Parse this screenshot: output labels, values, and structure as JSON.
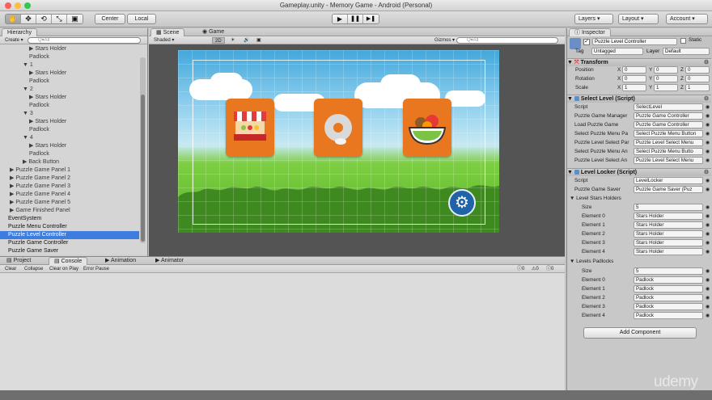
{
  "window": {
    "title": "Gameplay.unity - Memory Game - Android (Personal)"
  },
  "toolbar": {
    "tools": [
      "hand-icon",
      "move-icon",
      "rotate-icon",
      "scale-icon",
      "rect-icon"
    ],
    "center_label": "Center",
    "local_label": "Local",
    "layers_label": "Layers",
    "layout_label": "Layout",
    "account_label": "Account"
  },
  "hierarchy": {
    "tab_label": "Hierarchy",
    "create_label": "Create",
    "search_placeholder": "Q▾All",
    "rows": [
      {
        "text": "▶ Stars Holder",
        "indent": 36,
        "bold": false,
        "selected": false
      },
      {
        "text": "Padlock",
        "indent": 36,
        "bold": false,
        "selected": false
      },
      {
        "text": "▼ 1",
        "indent": 28,
        "bold": false,
        "selected": false
      },
      {
        "text": "▶ Stars Holder",
        "indent": 36,
        "bold": false,
        "selected": false
      },
      {
        "text": "Padlock",
        "indent": 36,
        "bold": false,
        "selected": false
      },
      {
        "text": "▼ 2",
        "indent": 28,
        "bold": false,
        "selected": false
      },
      {
        "text": "▶ Stars Holder",
        "indent": 36,
        "bold": false,
        "selected": false
      },
      {
        "text": "Padlock",
        "indent": 36,
        "bold": false,
        "selected": false
      },
      {
        "text": "▼ 3",
        "indent": 28,
        "bold": false,
        "selected": false
      },
      {
        "text": "▶ Stars Holder",
        "indent": 36,
        "bold": false,
        "selected": false
      },
      {
        "text": "Padlock",
        "indent": 36,
        "bold": false,
        "selected": false
      },
      {
        "text": "▼ 4",
        "indent": 28,
        "bold": false,
        "selected": false
      },
      {
        "text": "▶ Stars Holder",
        "indent": 36,
        "bold": false,
        "selected": false
      },
      {
        "text": "Padlock",
        "indent": 36,
        "bold": false,
        "selected": false
      },
      {
        "text": "▶ Back Button",
        "indent": 28,
        "bold": false,
        "selected": false
      },
      {
        "text": "▶ Puzzle Game Panel 1",
        "indent": 12,
        "bold": false,
        "selected": false
      },
      {
        "text": "▶ Puzzle Game Panel 2",
        "indent": 12,
        "bold": false,
        "selected": false
      },
      {
        "text": "▶ Puzzle Game Panel 3",
        "indent": 12,
        "bold": false,
        "selected": false
      },
      {
        "text": "▶ Puzzle Game Panel 4",
        "indent": 12,
        "bold": false,
        "selected": false
      },
      {
        "text": "▶ Puzzle Game Panel 5",
        "indent": 12,
        "bold": false,
        "selected": false
      },
      {
        "text": "▶ Game Finished Panel",
        "indent": 12,
        "bold": false,
        "selected": false
      },
      {
        "text": "EventSystem",
        "indent": 10,
        "bold": true,
        "selected": false
      },
      {
        "text": "Puzzle Menu Controller",
        "indent": 10,
        "bold": true,
        "selected": false
      },
      {
        "text": "Puzzle Level Controller",
        "indent": 10,
        "bold": true,
        "selected": true
      },
      {
        "text": "Puzzle Game Controller",
        "indent": 10,
        "bold": true,
        "selected": false
      },
      {
        "text": "Puzzle Game Saver",
        "indent": 10,
        "bold": true,
        "selected": false
      }
    ]
  },
  "scene": {
    "tab_scene": "Scene",
    "tab_game": "Game",
    "shading": "Shaded",
    "mode_2d": "2D",
    "gizmos": "Gizmos",
    "search_placeholder": "Q▾All"
  },
  "bottom": {
    "tab_project": "Project",
    "tab_console": "Console",
    "tab_animation": "Animation",
    "tab_animator": "Animator",
    "clear": "Clear",
    "collapse": "Collapse",
    "clear_on_play": "Clear on Play",
    "error_pause": "Error Pause",
    "count_errors": "0",
    "count_warnings": "0",
    "count_messages": "0"
  },
  "inspector": {
    "tab_label": "Inspector",
    "object_name": "Puzzle Level Controller",
    "static_label": "Static",
    "tag_label": "Tag",
    "tag_value": "Untagged",
    "layer_label": "Layer",
    "layer_value": "Default",
    "transform": {
      "title": "Transform",
      "position_label": "Position",
      "rotation_label": "Rotation",
      "scale_label": "Scale",
      "position": [
        "0",
        "0",
        "0"
      ],
      "rotation": [
        "0",
        "0",
        "0"
      ],
      "scale": [
        "1",
        "1",
        "1"
      ]
    },
    "select_level": {
      "title": "Select Level (Script)",
      "rows": [
        {
          "label": "Script",
          "value": "SelectLevel"
        },
        {
          "label": "Puzzle Game Manager",
          "value": "Puzzle Game Controller"
        },
        {
          "label": "Load Puzzle Game",
          "value": "Puzzle Game Controller"
        },
        {
          "label": "Select Puzzle Menu Pa",
          "value": "Select Puzzle Menu Button"
        },
        {
          "label": "Puzzle Level Select Par",
          "value": "Puzzle Level Select Menu"
        },
        {
          "label": "Select Puzzle Menu An",
          "value": "Select Puzzle Menu Butto"
        },
        {
          "label": "Puzzle Level Select An",
          "value": "Puzzle Level Select Menu"
        }
      ]
    },
    "level_locker": {
      "title": "Level Locker (Script)",
      "script_label": "Script",
      "script_value": "LevelLocker",
      "saver_label": "Puzzle Game Saver",
      "saver_value": "Puzzle Game Saver (Puz",
      "stars_title": "▼ Level Stars Holders",
      "stars_size_label": "Size",
      "stars_size": "5",
      "stars_elements": [
        {
          "label": "Element 0",
          "value": "Stars Holder"
        },
        {
          "label": "Element 1",
          "value": "Stars Holder"
        },
        {
          "label": "Element 2",
          "value": "Stars Holder"
        },
        {
          "label": "Element 3",
          "value": "Stars Holder"
        },
        {
          "label": "Element 4",
          "value": "Stars Holder"
        }
      ],
      "padlocks_title": "▼ Levels Padlocks",
      "padlocks_size_label": "Size",
      "padlocks_size": "5",
      "padlocks_elements": [
        {
          "label": "Element 0",
          "value": "Padlock"
        },
        {
          "label": "Element 1",
          "value": "Padlock"
        },
        {
          "label": "Element 2",
          "value": "Padlock"
        },
        {
          "label": "Element 3",
          "value": "Padlock"
        },
        {
          "label": "Element 4",
          "value": "Padlock"
        }
      ]
    },
    "add_component": "Add Component"
  },
  "watermark": "udemy",
  "colors": {
    "selection": "#3e7de0",
    "card": "#e9771f",
    "settings_button": "#1f63a8"
  }
}
